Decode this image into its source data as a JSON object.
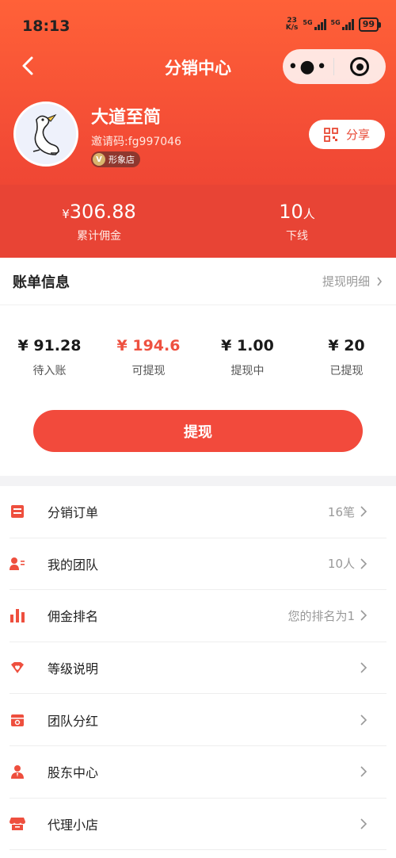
{
  "status_bar": {
    "time": "18:13",
    "net_speed_top": "23",
    "net_speed_bottom": "K/s",
    "signal1_label": "5G",
    "signal2_label": "5G",
    "battery": "99"
  },
  "nav": {
    "title": "分销中心",
    "more_glyph": "•●•"
  },
  "profile": {
    "name": "大道至简",
    "invite_code": "邀请码:fg997046",
    "badge_icon_letter": "V",
    "badge_label": "形象店",
    "share_label": "分享"
  },
  "stats": {
    "commission_currency": "¥",
    "commission_value": "306.88",
    "commission_label": "累计佣金",
    "downline_value": "10",
    "downline_unit": "人",
    "downline_label": "下线"
  },
  "bill": {
    "title": "账单信息",
    "detail_link": "提现明细",
    "amounts": [
      {
        "value": "¥ 91.28",
        "label": "待入账"
      },
      {
        "value": "¥ 194.6",
        "label": "可提现"
      },
      {
        "value": "¥ 1.00",
        "label": "提现中"
      },
      {
        "value": "¥ 20",
        "label": "已提现"
      }
    ],
    "withdraw_button": "提现"
  },
  "menu": [
    {
      "label": "分销订单",
      "value": "16笔",
      "icon": "order-list-icon"
    },
    {
      "label": "我的团队",
      "value": "10人",
      "icon": "team-icon"
    },
    {
      "label": "佣金排名",
      "value": "您的排名为1",
      "icon": "bar-chart-icon"
    },
    {
      "label": "等级说明",
      "value": "",
      "icon": "diamond-heart-icon"
    },
    {
      "label": "团队分红",
      "value": "",
      "icon": "bonus-box-icon"
    },
    {
      "label": "股东中心",
      "value": "",
      "icon": "shareholder-icon"
    },
    {
      "label": "代理小店",
      "value": "",
      "icon": "shop-icon"
    }
  ],
  "colors": {
    "accent": "#f24a3c",
    "header_top": "#ff6138",
    "header_band": "#e84435",
    "highlight_amount": "#ee5140"
  }
}
